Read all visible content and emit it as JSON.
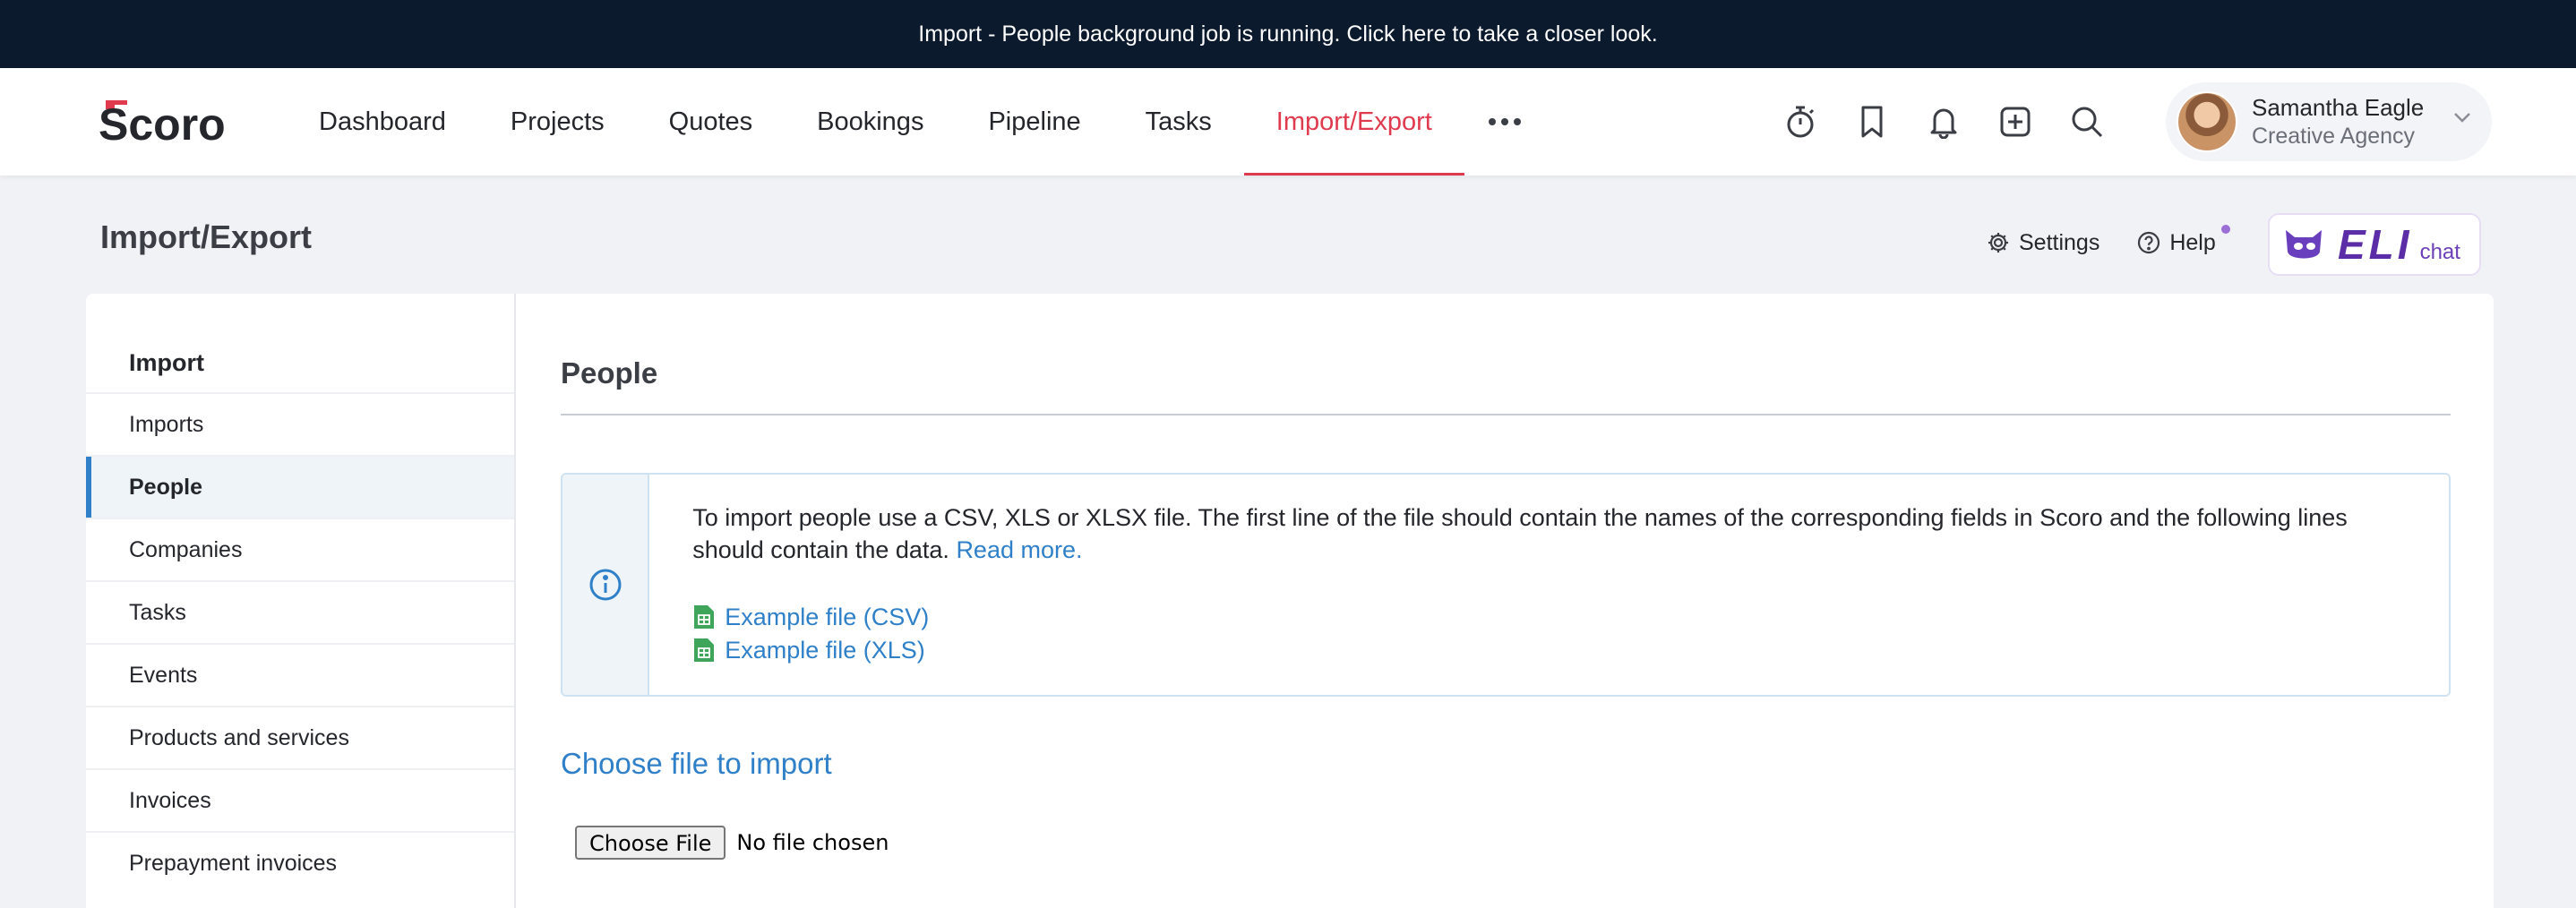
{
  "banner": {
    "text": "Import - People background job is running. Click here to take a closer look."
  },
  "header": {
    "logo_text": "Scoro",
    "nav": [
      {
        "label": "Dashboard"
      },
      {
        "label": "Projects"
      },
      {
        "label": "Quotes"
      },
      {
        "label": "Bookings"
      },
      {
        "label": "Pipeline"
      },
      {
        "label": "Tasks"
      },
      {
        "label": "Import/Export",
        "active": true
      }
    ],
    "icons": [
      "more-icon",
      "stopwatch-icon",
      "bookmark-icon",
      "bell-icon",
      "add-icon",
      "search-icon"
    ],
    "user": {
      "name": "Samantha Eagle",
      "company": "Creative Agency"
    }
  },
  "page": {
    "title": "Import/Export",
    "actions": {
      "settings": "Settings",
      "help": "Help"
    },
    "eli": {
      "brand": "ELI",
      "sub": "chat"
    }
  },
  "sidebar": {
    "heading": "Import",
    "items": [
      {
        "label": "Imports"
      },
      {
        "label": "People",
        "active": true
      },
      {
        "label": "Companies"
      },
      {
        "label": "Tasks"
      },
      {
        "label": "Events"
      },
      {
        "label": "Products and services"
      },
      {
        "label": "Invoices"
      },
      {
        "label": "Prepayment invoices"
      }
    ]
  },
  "content": {
    "section_title": "People",
    "info": {
      "text": "To import people use a CSV, XLS or XLSX file. The first line of the file should contain the names of the corresponding fields in Scoro and the following lines should contain the data.",
      "read_more": "Read more.",
      "files": [
        {
          "label": "Example file (CSV)"
        },
        {
          "label": "Example file (XLS)"
        }
      ]
    },
    "choose_title": "Choose file to import",
    "file_button": "Choose File",
    "file_status": "No file chosen"
  },
  "colors": {
    "banner_bg": "#0c1a2e",
    "accent_red": "#e03a4e",
    "link_blue": "#2f80c9",
    "eli_purple": "#5b2ea8",
    "page_bg": "#f1f2f6"
  }
}
